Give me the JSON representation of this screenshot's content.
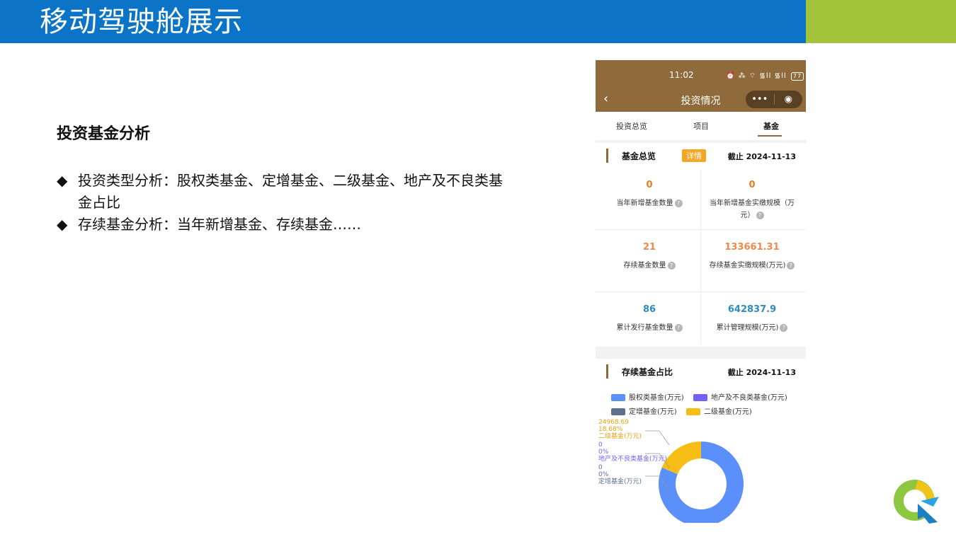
{
  "banner": {
    "title": "移动驾驶舱展示"
  },
  "left": {
    "section_title": "投资基金分析",
    "bullets": [
      {
        "mark": "◆",
        "text": "投资类型分析：股权类基金、定增基金、二级基金、地产及不良类基金占比"
      },
      {
        "mark": "◆",
        "text": "存续基金分析：当年新增基金、存续基金……"
      }
    ]
  },
  "phone": {
    "status": {
      "time": "11:02",
      "icons": "⏰ ⁂ ⌔ ᯾ll ᯾ll",
      "battery": "77"
    },
    "titlebar": {
      "back_glyph": "‹",
      "title": "投资情况",
      "more_glyph": "•••",
      "target_glyph": "◉"
    },
    "tabs": [
      {
        "label": "投资总览"
      },
      {
        "label": "项目"
      },
      {
        "label": "基金"
      }
    ],
    "overview": {
      "title": "基金总览",
      "detail_label": "详情",
      "as_of": "截止 2024-11-13",
      "help_glyph": "?",
      "cells": [
        {
          "value": "0",
          "label": "当年新增基金数量",
          "color": "#e67e22"
        },
        {
          "value": "0",
          "label": "当年新增基金实缴规模（万元）",
          "color": "#e67e22"
        },
        {
          "value": "21",
          "label": "存续基金数量",
          "color": "#f0884a"
        },
        {
          "value": "133661.31",
          "label": "存续基金实缴规模(万元)",
          "color": "#f0884a"
        },
        {
          "value": "86",
          "label": "累计发行基金数量",
          "color": "#2e8bbf"
        },
        {
          "value": "642837.9",
          "label": "累计管理规模(万元)",
          "color": "#2e8bbf"
        }
      ]
    },
    "ratio": {
      "title": "存续基金占比",
      "as_of": "截止 2024-11-13"
    },
    "accent_color": "#8f6b3b"
  },
  "chart_data": {
    "type": "pie",
    "legend": [
      "股权类基金(万元)",
      "地产及不良类基金(万元)",
      "定增基金(万元)",
      "二级基金(万元)"
    ],
    "slices": [
      {
        "name": "股权类基金(万元)",
        "value": 108692.62,
        "percent": 81.32,
        "color": "#5b8ff9",
        "labeled": false
      },
      {
        "name": "二级基金(万元)",
        "value": 24968.69,
        "percent": 18.68,
        "color": "#f6bd16",
        "labeled": true,
        "value_label": "24968.69",
        "percent_label": "18.68%"
      },
      {
        "name": "地产及不良类基金(万元)",
        "value": 0,
        "percent": 0,
        "color": "#7262fd",
        "labeled": true,
        "value_label": "0",
        "percent_label": "0%"
      },
      {
        "name": "定增基金(万元)",
        "value": 0,
        "percent": 0,
        "color": "#5d7092",
        "labeled": true,
        "value_label": "0",
        "percent_label": "0%"
      }
    ]
  }
}
